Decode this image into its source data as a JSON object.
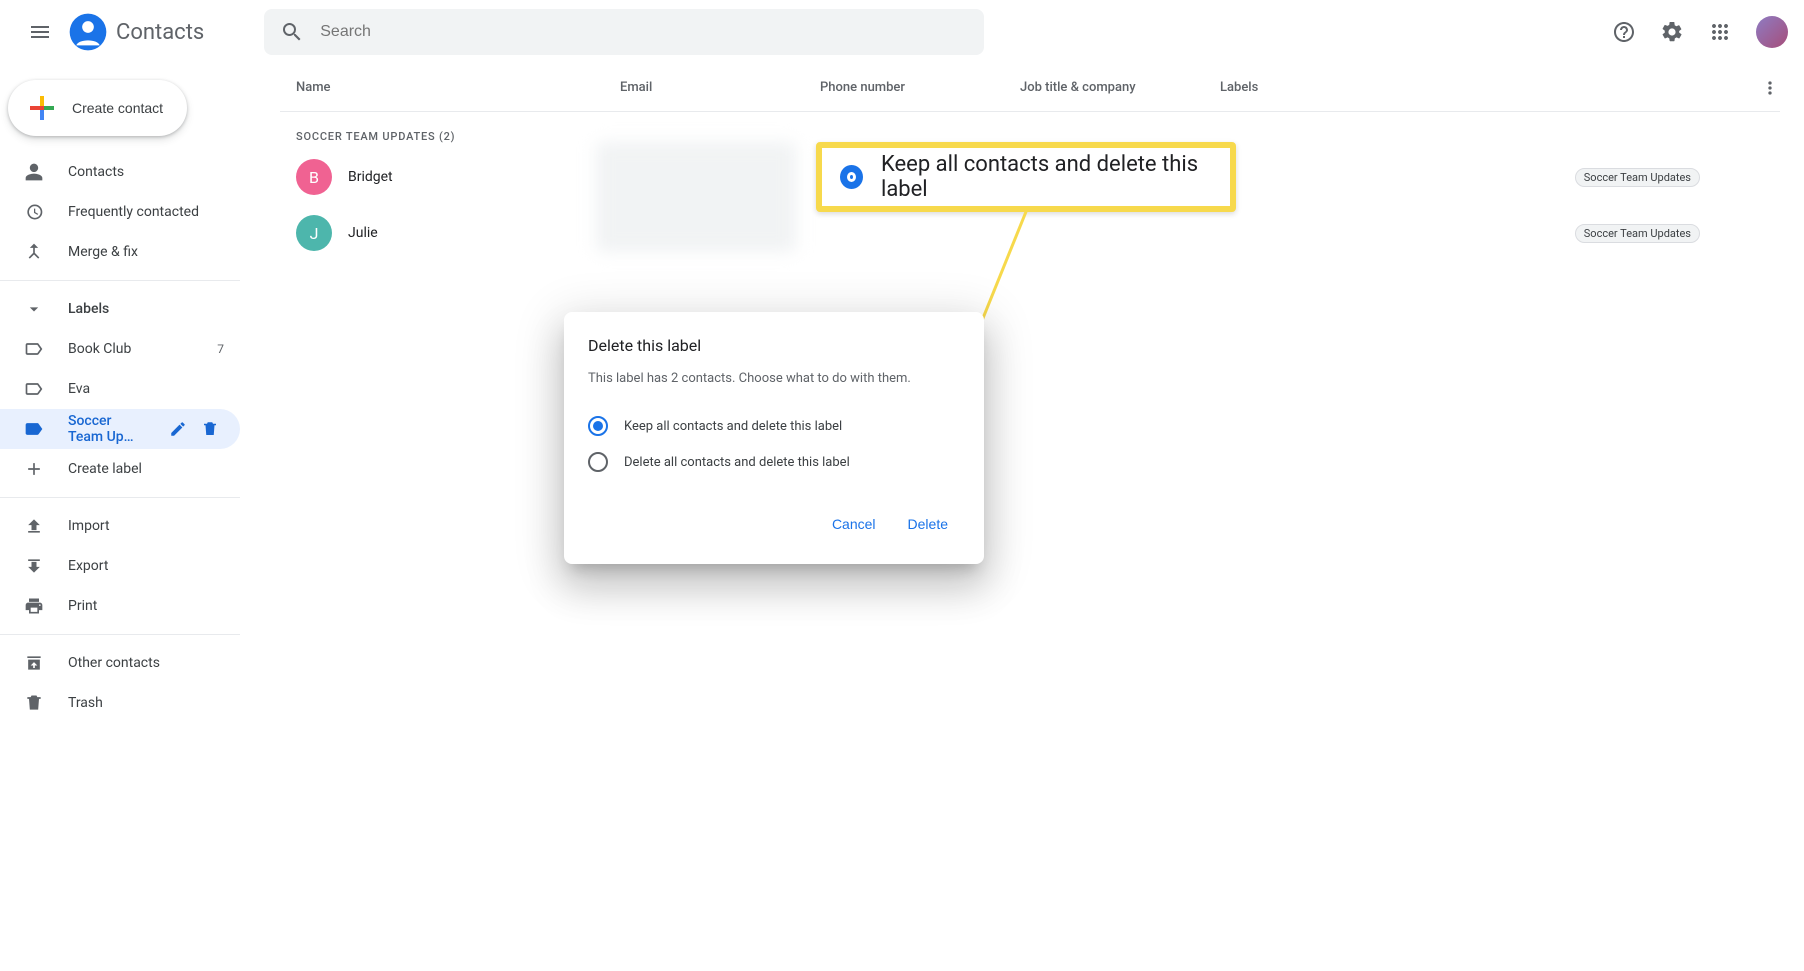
{
  "app": {
    "name": "Contacts"
  },
  "search": {
    "placeholder": "Search"
  },
  "create_button": "Create contact",
  "sidebar": {
    "contacts": "Contacts",
    "frequent": "Frequently contacted",
    "merge": "Merge & fix",
    "labels_heading": "Labels",
    "labels": [
      {
        "name": "Book Club",
        "count": "7"
      },
      {
        "name": "Eva",
        "count": ""
      },
      {
        "name": "Soccer Team Up…",
        "count": ""
      }
    ],
    "create_label": "Create label",
    "import": "Import",
    "export": "Export",
    "print": "Print",
    "other": "Other contacts",
    "trash": "Trash"
  },
  "columns": {
    "name": "Name",
    "email": "Email",
    "phone": "Phone number",
    "job": "Job title & company",
    "labels": "Labels"
  },
  "group_title": "SOCCER TEAM UPDATES (2)",
  "contacts": [
    {
      "initial": "B",
      "name": "Bridget",
      "avatar_color": "#f06292",
      "chip": "Soccer Team Updates"
    },
    {
      "initial": "J",
      "name": "Julie",
      "avatar_color": "#4db6ac",
      "chip": "Soccer Team Updates"
    }
  ],
  "callout_text": "Keep all contacts and delete this label",
  "modal": {
    "title": "Delete this label",
    "body": "This label has 2 contacts. Choose what to do with them.",
    "opt_keep": "Keep all contacts and delete this label",
    "opt_delete": "Delete all contacts and delete this label",
    "cancel": "Cancel",
    "delete": "Delete"
  }
}
